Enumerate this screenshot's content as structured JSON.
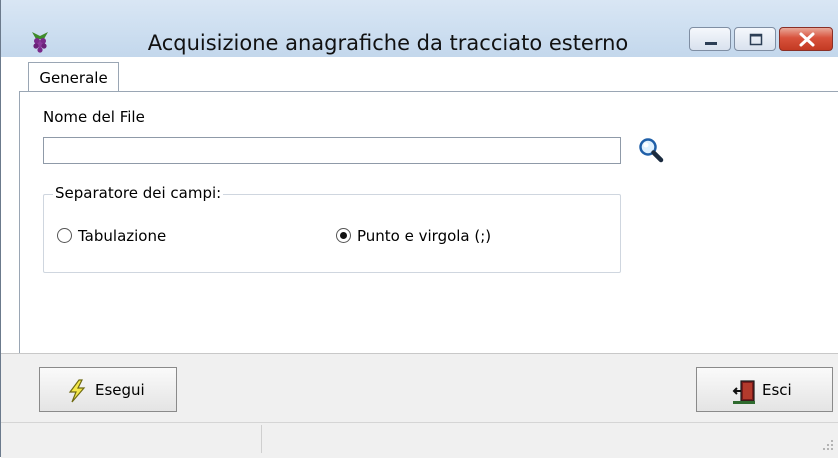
{
  "window": {
    "title": "Acquisizione anagrafiche da tracciato esterno",
    "app_icon": "grape-icon",
    "controls": [
      "minimize-icon",
      "maximize-icon",
      "close-icon"
    ]
  },
  "tabs": [
    {
      "label": "Generale",
      "active": true
    }
  ],
  "file": {
    "label": "Nome del File",
    "value": "",
    "placeholder": "",
    "browse_icon": "magnifier-icon"
  },
  "separator": {
    "legend": "Separatore dei campi:",
    "options": [
      {
        "label": "Tabulazione",
        "selected": false
      },
      {
        "label": "Punto e virgola (;)",
        "selected": true
      }
    ]
  },
  "actions": {
    "run_label": "Esegui",
    "run_icon": "lightning-icon",
    "exit_label": "Esci",
    "exit_icon": "exit-door-icon"
  },
  "colors": {
    "title_bar": "#cfe0f1",
    "close_button": "#d8523c",
    "footer": "#f0f0f0"
  }
}
